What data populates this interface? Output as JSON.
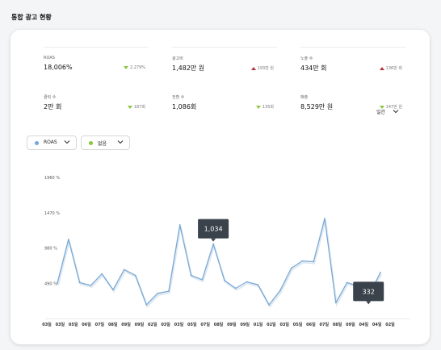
{
  "page": {
    "title": "통합 광고 현황"
  },
  "kpis": [
    {
      "label": "ROAS",
      "value": "18,006%",
      "delta": "2,279%",
      "direction": "down"
    },
    {
      "label": "광고비",
      "value": "1,482만 원",
      "delta": "193만 원",
      "direction": "up"
    },
    {
      "label": "노출 수",
      "value": "434만 회",
      "delta": "136만 회",
      "direction": "up"
    },
    {
      "label": "클릭 수",
      "value": "2만 회",
      "delta": "187회",
      "direction": "down"
    },
    {
      "label": "전환 수",
      "value": "1,086회",
      "delta": "135회",
      "direction": "down"
    },
    {
      "label": "매출",
      "value": "8,529만 원",
      "delta": "147만 원",
      "direction": "down"
    }
  ],
  "controls": {
    "metric_select": {
      "value": "ROAS",
      "dot_color": "#6fa8dc"
    },
    "compare_select": {
      "value": "없음",
      "dot_color": "#8cc63f"
    },
    "period_select": {
      "value": "일간"
    }
  },
  "colors": {
    "line": "#7aa9d3",
    "up": "#b8333b",
    "down": "#8cc63f",
    "tooltip": "#3a434b"
  },
  "chart_data": {
    "type": "line",
    "y_tick_labels": [
      "1960 %",
      "1470 %",
      "980 %",
      "490 %"
    ],
    "ylim": [
      0,
      1960
    ],
    "x_tick_labels": [
      "03일",
      "03일",
      "05일",
      "06일",
      "07일",
      "08일",
      "09일",
      "09일",
      "02일",
      "03일",
      "03일",
      "05일",
      "07일",
      "08일",
      "09일",
      "09일",
      "01일",
      "02일",
      "03일",
      "05일",
      "06일",
      "07일",
      "08일",
      "09일",
      "04일",
      "04일",
      "02일"
    ],
    "series": [
      {
        "values": [
          490,
          1100,
          500,
          460,
          620,
          400,
          680,
          600,
          190,
          350,
          380,
          1300,
          600,
          540,
          1034,
          530,
          420,
          510,
          470,
          190,
          390,
          700,
          800,
          790,
          1390,
          220,
          500,
          450,
          332,
          640
        ]
      }
    ],
    "tooltips": [
      {
        "label": "1,034",
        "index": 14
      },
      {
        "label": "332",
        "index": 28
      }
    ],
    "grid": false,
    "legend": "none"
  }
}
